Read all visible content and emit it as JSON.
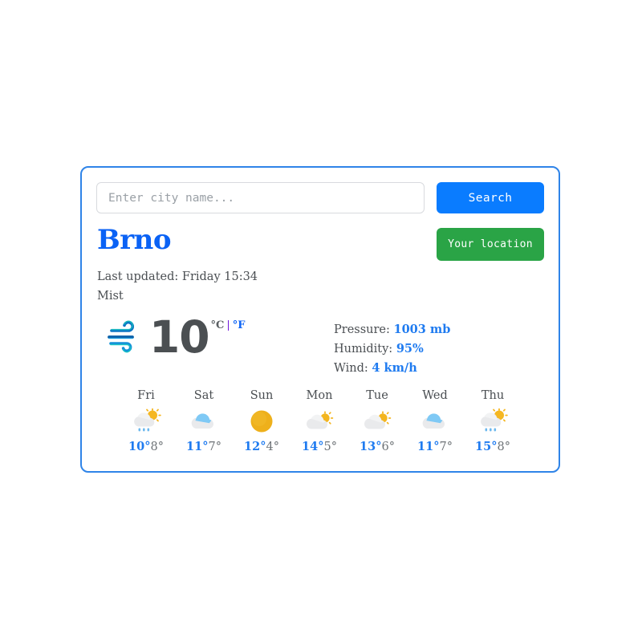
{
  "search": {
    "placeholder": "Enter city name...",
    "value": "",
    "button_label": "Search"
  },
  "location": {
    "city": "Brno",
    "button_label": "Your location",
    "last_updated": "Last updated: Friday 15:34",
    "condition": "Mist"
  },
  "current": {
    "icon": "wind-mist-icon",
    "temperature": "10",
    "unit_active": "°C",
    "unit_separator": "|",
    "unit_alternate": "°F",
    "details": [
      {
        "label": "Pressure:",
        "value": "1003 mb",
        "name": "pressure"
      },
      {
        "label": "Humidity:",
        "value": "95%",
        "name": "humidity"
      },
      {
        "label": "Wind:",
        "value": "4 km/h",
        "name": "wind"
      }
    ]
  },
  "forecast": [
    {
      "day": "Fri",
      "icon": "sun-cloud-rain-icon",
      "max": "10°",
      "min": "8°"
    },
    {
      "day": "Sat",
      "icon": "cloud-icon",
      "max": "11°",
      "min": "7°"
    },
    {
      "day": "Sun",
      "icon": "sun-icon",
      "max": "12°",
      "min": "4°"
    },
    {
      "day": "Mon",
      "icon": "sun-cloud-icon",
      "max": "14°",
      "min": "5°"
    },
    {
      "day": "Tue",
      "icon": "sun-cloud-icon",
      "max": "13°",
      "min": "6°"
    },
    {
      "day": "Wed",
      "icon": "cloud-icon",
      "max": "11°",
      "min": "7°"
    },
    {
      "day": "Thu",
      "icon": "sun-cloud-rain-icon",
      "max": "15°",
      "min": "8°"
    }
  ],
  "colors": {
    "card_border": "#2f84e8",
    "search_button": "#0a7cff",
    "location_button": "#2aa446",
    "accent_blue": "#0a62f5",
    "value_blue": "#1f7bf0",
    "temperature_grey": "#4b4f52",
    "sun_yellow": "#f0b11d",
    "cloud_grey": "#e8e9ea",
    "cloud_blue": "#7fc9f5",
    "rain_blue": "#6cb8ee",
    "wind_dark": "#0b5ea8",
    "wind_teal": "#10c4c0"
  }
}
